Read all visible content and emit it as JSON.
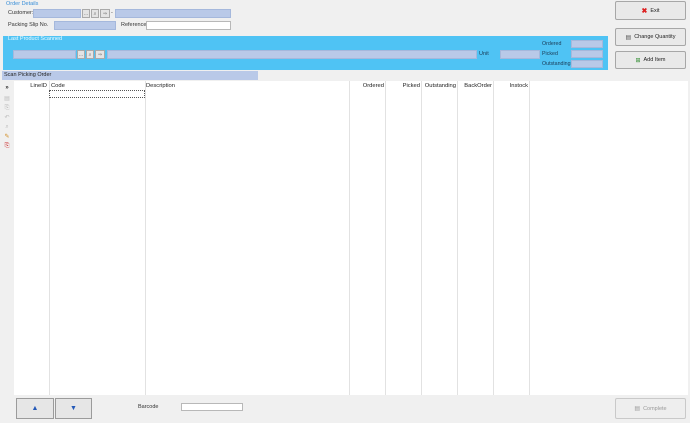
{
  "order_details": {
    "section_label": "Order Details",
    "customer_label": "Customer:",
    "packing_slip_label": "Packing Slip No.",
    "reference_label": "Reference",
    "customer_value": "",
    "customer_name_value": "",
    "packing_slip_value": "",
    "reference_value": ""
  },
  "scan": {
    "section_label": "Last Product Scanned",
    "code_value": "",
    "description_value": "",
    "unit_label": "Unit",
    "unit_value": "",
    "ordered_label": "Ordered",
    "picked_label": "Picked",
    "outstanding_label": "Outstanding",
    "ordered_value": "",
    "picked_value": "",
    "outstanding_value": ""
  },
  "buttons": {
    "exit": "Exit",
    "change_quantity": "Change Quantity",
    "add_item": "Add Item",
    "complete": "Complete"
  },
  "grid": {
    "section_label": "Scan Picking Order",
    "columns": [
      "LineID",
      "Code",
      "Description",
      "Ordered",
      "Picked",
      "Outstanding",
      "BackOrder",
      "Instock"
    ],
    "code_edit_value": ""
  },
  "bottom": {
    "barcode_label": "Barcode",
    "barcode_value": ""
  },
  "colors": {
    "scan_panel": "#4fc3f4",
    "field_blue": "#b9c9e8",
    "accent_blue": "#3a8fd8"
  },
  "icons": [
    "ellipsis-icon",
    "lookup-icon",
    "exit-x-icon",
    "change-quantity-icon",
    "add-item-icon",
    "complete-icon",
    "up-arrow-icon",
    "down-arrow-icon",
    "double-chevron-icon",
    "row-action-icons"
  ]
}
